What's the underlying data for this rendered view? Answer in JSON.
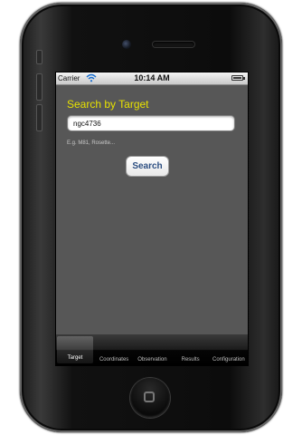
{
  "statusbar": {
    "carrier": "Carrier",
    "time": "10:14 AM"
  },
  "search": {
    "title": "Search by Target",
    "value": "ngc4736",
    "hint": "E.g. M81, Rosette...",
    "button_label": "Search"
  },
  "tabbar": {
    "tabs": [
      {
        "label": "Target",
        "active": true
      },
      {
        "label": "Coordinates",
        "active": false
      },
      {
        "label": "Observation",
        "active": false
      },
      {
        "label": "Results",
        "active": false
      },
      {
        "label": "Configuration",
        "active": false
      }
    ]
  },
  "colors": {
    "title": "#e7e100",
    "screen_bg": "#575757",
    "button_text": "#2d4f82"
  },
  "icons": [
    "wifi-icon",
    "battery-icon",
    "camera-icon",
    "speaker-icon",
    "home-button-icon"
  ]
}
